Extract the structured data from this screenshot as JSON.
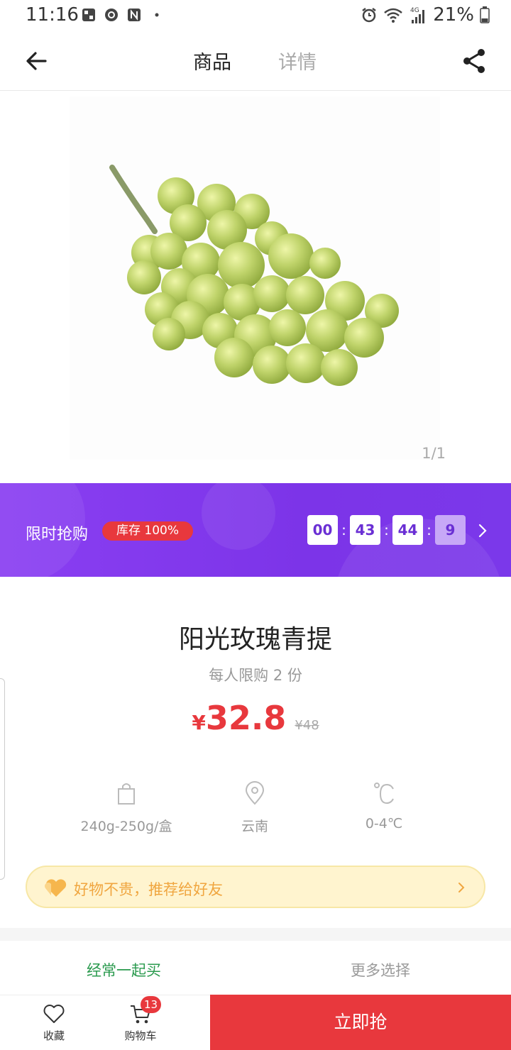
{
  "status_bar": {
    "time": "11:16",
    "battery": "21%",
    "network": "4G",
    "icons_left": [
      "notification-icon",
      "sync-icon",
      "nfc-icon",
      "dot-icon"
    ],
    "icons_right": [
      "alarm-icon",
      "wifi-icon",
      "signal-icon",
      "battery-icon"
    ]
  },
  "nav": {
    "tabs": [
      {
        "label": "商品",
        "active": true
      },
      {
        "label": "详情",
        "active": false
      }
    ],
    "back_icon": "arrow-left-icon",
    "share_icon": "share-icon"
  },
  "gallery": {
    "counter": "1/1",
    "image": "green-grapes-photo"
  },
  "flash_sale": {
    "label": "限时抢购",
    "stock": "库存 100%",
    "countdown": [
      "00",
      "43",
      "44",
      "9"
    ],
    "separator": ":"
  },
  "product": {
    "title": "阳光玫瑰青提",
    "limit": "每人限购 2 份",
    "price_symbol": "¥",
    "price": "32.8",
    "original_price": "¥48"
  },
  "specs": [
    {
      "icon": "bag-icon",
      "text": "240g-250g/盒"
    },
    {
      "icon": "location-icon",
      "text": "云南"
    },
    {
      "icon": "temperature-icon",
      "text": "0-4℃"
    }
  ],
  "share_banner": {
    "text": "好物不贵，推荐给好友"
  },
  "recommend_tabs": [
    {
      "label": "经常一起买",
      "active": true
    },
    {
      "label": "更多选择",
      "active": false
    }
  ],
  "bottom_bar": {
    "favorite_label": "收藏",
    "cart_label": "购物车",
    "cart_count": "13",
    "buy_label": "立即抢"
  },
  "colors": {
    "accent_red": "#e8383d",
    "flash_purple": "#7c34e8",
    "active_green": "#2a9a4e",
    "share_orange": "#f0a640"
  }
}
